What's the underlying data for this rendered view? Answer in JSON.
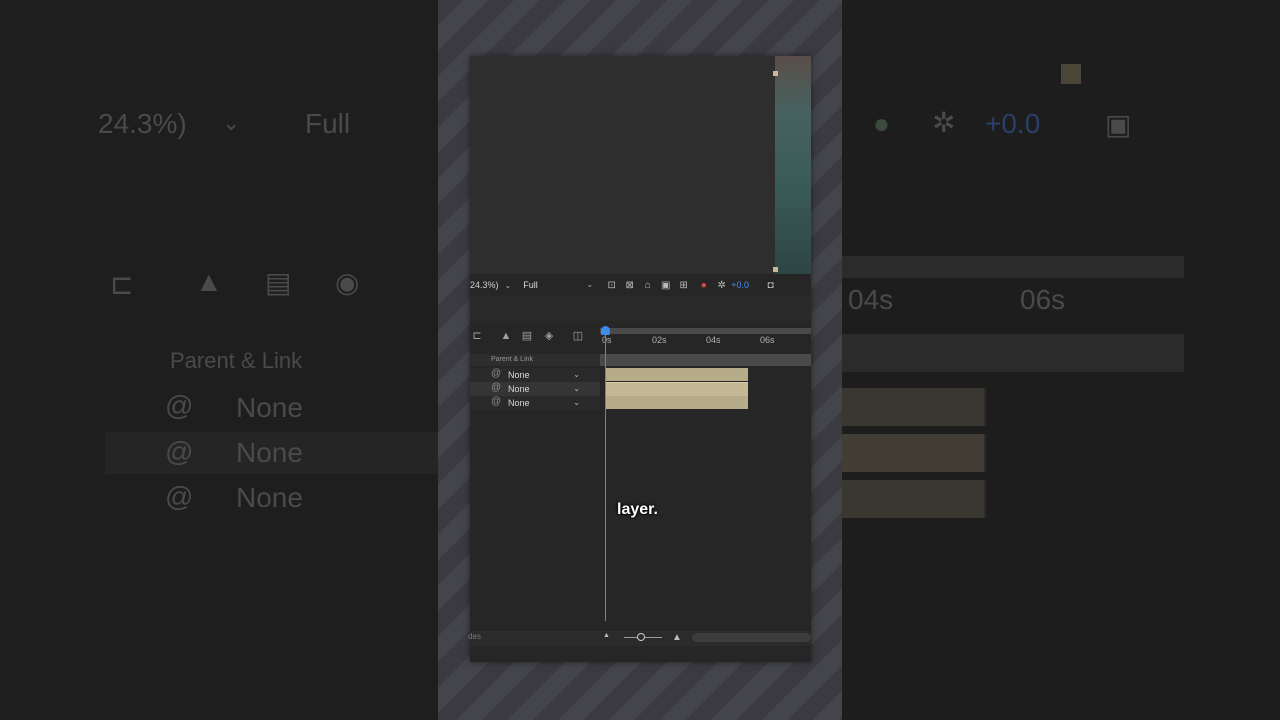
{
  "background": {
    "zoom_text": "24.3%)",
    "resolution_text": "Full",
    "exposure_text": "+0.0",
    "tick_04": "04s",
    "tick_06": "06s",
    "column_header": "Parent & Link",
    "parent_values": [
      "None",
      "None",
      "None"
    ]
  },
  "viewer_toolbar": {
    "zoom": "24.3%)",
    "resolution": "Full",
    "exposure": "+0.0"
  },
  "timeline": {
    "ticks": [
      "0s",
      "02s",
      "04s",
      "06s"
    ],
    "column_header": "Parent & Link",
    "layers": [
      {
        "parent": "None",
        "highlighted": false
      },
      {
        "parent": "None",
        "highlighted": true
      },
      {
        "parent": "None",
        "highlighted": false
      }
    ],
    "bottom_label": "des"
  },
  "caption": "layer.",
  "colors": {
    "accent": "#3d8dea",
    "layer_bar": "#b7ac8a",
    "exposure_blue": "#4a8cff"
  }
}
